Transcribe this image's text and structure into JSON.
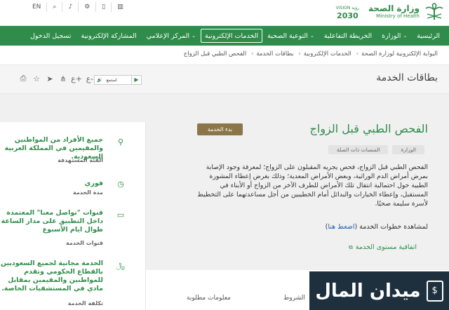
{
  "utility": {
    "lang": "EN",
    "items": [
      "search-icon",
      "translate-icon",
      "settings-icon",
      "mobile-icon",
      "stats-icon"
    ]
  },
  "branding": {
    "ministry_ar": "وزارة الصحة",
    "ministry_en": "Ministry of Health",
    "vision_year": "2030",
    "vision_label": "VISION رؤية"
  },
  "nav": {
    "items": [
      {
        "label": "الرئيسية",
        "dropdown": false,
        "active": false
      },
      {
        "label": "الوزارة",
        "dropdown": true,
        "active": false
      },
      {
        "label": "الخريطة التفاعلية",
        "dropdown": false,
        "active": false
      },
      {
        "label": "التوعية الصحية",
        "dropdown": true,
        "active": false
      },
      {
        "label": "الخدمات الإلكترونية",
        "dropdown": false,
        "active": true
      },
      {
        "label": "المركز الإعلامي",
        "dropdown": true,
        "active": false
      },
      {
        "label": "المشاركة الإلكترونية",
        "dropdown": false,
        "active": false
      },
      {
        "label": "تسجيل الدخول",
        "dropdown": false,
        "active": false
      }
    ]
  },
  "breadcrumb": [
    "البوابة الإلكترونية لوزارة الصحة",
    "الخدمات الإلكترونية",
    "بطاقات الخدمة",
    "الفحص الطبي قبل الزواج"
  ],
  "page": {
    "title": "بطاقات الخدمة",
    "listen_label": "استمع"
  },
  "service": {
    "title": "الفحص الطبي قبل الزواج",
    "start_button": "بدء الخدمة",
    "tags": [
      "الوزارة",
      "المنصات ذات الصلة"
    ],
    "description": "الفحص الطبي قبل الزواج، فحص يجريه المقبلون على الزواج؛ لمعرفة وجود الإصابة بمرض أمراض الدم الوراثية، وبعض الأمراض المعدية؛ وذلك بغرض إعطاء المشورة الطبية حول احتمالية انتقال تلك الأمراض للطرف الآخر من الزواج أو الأبناء في المستقبل، وإعطاء الخيارات والبدائل أمام الخطيبين من أجل مساعدتهما على التخطيط لأسرة سليمة صحيًا.",
    "steps_text": "لمشاهدة خطوات الخدمة (",
    "steps_link": "اضغط هنا",
    "steps_close": ")",
    "agreement": "اتفاقية مستوى الخدمة"
  },
  "sidebar": {
    "rows": [
      {
        "icon": "person-icon",
        "value": "جميع الأفراد من المواطنين والمقيمين في المملكة العربية السعودية.",
        "label": "الفئة المستهدفة"
      },
      {
        "icon": "clock-icon",
        "value": "فوري",
        "label": "مدة الخدمة"
      },
      {
        "icon": "monitor-icon",
        "value": "قنوات \"تواصل معنا\" المعتمدة داخل التطبيق على مدار الساعة طوال ايام الأسبوع",
        "label": "قنوات الخدمة"
      },
      {
        "icon": "money-icon",
        "value": "الخدمة مجانية لجميع السعوديين بالقطاع الحكومي وتقدم للمواطنين والمقيمين بمقابل مادي في المستشفيات الخاصة.",
        "label": "تكلفة الخدمة"
      }
    ]
  },
  "bottom_tabs": [
    "الشروط",
    "معلومات مطلوبة"
  ],
  "watermark": {
    "text": "ميدان المال"
  },
  "colors": {
    "brand": "#2f8c4a",
    "button": "#8a7648",
    "link": "#1c5db5"
  }
}
